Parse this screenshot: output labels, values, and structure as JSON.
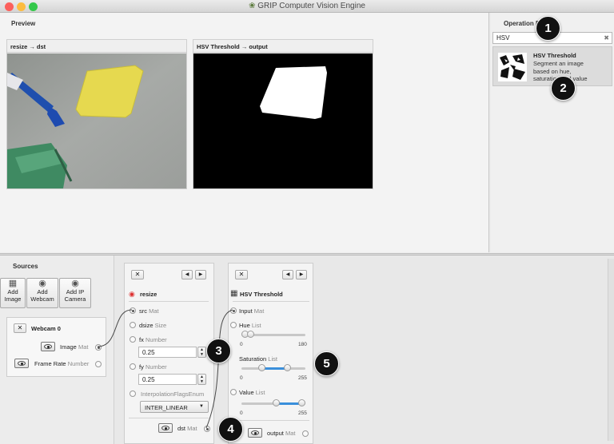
{
  "window": {
    "title": "GRIP Computer Vision Engine"
  },
  "preview": {
    "title": "Preview",
    "cards": [
      {
        "label": "resize → dst"
      },
      {
        "label": "HSV Threshold → output"
      }
    ]
  },
  "operations": {
    "title": "Operation Palette",
    "search_value": "HSV",
    "result": {
      "name": "HSV Threshold",
      "description": "Segment an image based on hue, saturation and value ranges."
    }
  },
  "sources": {
    "title": "Sources",
    "buttons": [
      {
        "label": "Add\nImage"
      },
      {
        "label": "Add\nWebcam"
      },
      {
        "label": "Add IP\nCamera"
      }
    ],
    "webcam": {
      "name": "Webcam 0",
      "outputs": [
        {
          "name": "Image",
          "type": "Mat"
        },
        {
          "name": "Frame Rate",
          "type": "Number"
        }
      ]
    }
  },
  "resize": {
    "name": "resize",
    "inputs": {
      "src": {
        "name": "src",
        "type": "Mat"
      },
      "dsize": {
        "name": "dsize",
        "type": "Size"
      },
      "fx": {
        "name": "fx",
        "type": "Number",
        "value": "0.25"
      },
      "fy": {
        "name": "fy",
        "type": "Number",
        "value": "0.25"
      },
      "interp": {
        "name": "InterpolationFlagsEnum",
        "value": "INTER_LINEAR"
      }
    },
    "output": {
      "name": "dst",
      "type": "Mat"
    }
  },
  "hsv": {
    "name": "HSV Threshold",
    "inputs": {
      "input": {
        "name": "Input",
        "type": "Mat"
      },
      "hue": {
        "name": "Hue",
        "type": "List",
        "min": "0",
        "max": "180",
        "low": 0.0,
        "high": 0.1
      },
      "sat": {
        "name": "Saturation",
        "type": "List",
        "min": "0",
        "max": "255",
        "low": 0.3,
        "high": 0.75
      },
      "val": {
        "name": "Value",
        "type": "List",
        "min": "0",
        "max": "255",
        "low": 0.55,
        "high": 1.0
      }
    },
    "output": {
      "name": "output",
      "type": "Mat"
    }
  },
  "callouts": [
    "1",
    "2",
    "3",
    "4",
    "5"
  ],
  "colors": {
    "accent": "#3a8fdb",
    "badge": "#111111"
  }
}
